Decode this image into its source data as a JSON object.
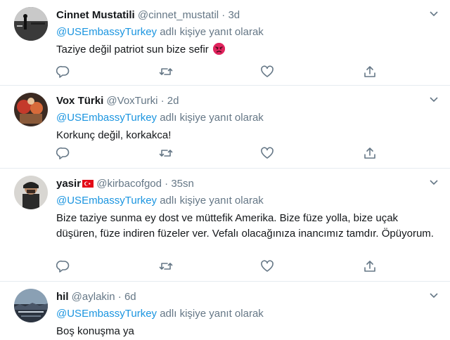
{
  "colors": {
    "accent": "#1b95e0",
    "muted": "#657786",
    "text": "#14171a",
    "divider": "#e6ecf0"
  },
  "tweets": [
    {
      "name": "Cinnet Mustatili",
      "handle": "@cinnet_mustatil",
      "sep": "·",
      "time": "3d",
      "reply_mention": "@USEmbassyTurkey",
      "reply_suffix": " adlı kişiye yanıt olarak",
      "text": "Taziye değil patriot sun bize sefir",
      "emoji": "angry-face-emoji"
    },
    {
      "name": "Vox Türki",
      "handle": "@VoxTurki",
      "sep": "·",
      "time": "2d",
      "reply_mention": "@USEmbassyTurkey",
      "reply_suffix": " adlı kişiye yanıt olarak",
      "text": "Korkunç değil, korkakca!"
    },
    {
      "name": "yasir",
      "flag": "turkey-flag-emoji",
      "handle": "@kirbacofgod",
      "sep": "·",
      "time": "35sn",
      "reply_mention": "@USEmbassyTurkey",
      "reply_suffix": " adlı kişiye yanıt olarak",
      "text": "Bize taziye sunma ey dost ve müttefik Amerika. Bize füze yolla, bize uçak düşüren, füze indiren füzeler ver. Vefalı olacağınıza inancımız tamdır. Öpüyorum."
    },
    {
      "name": "hil",
      "handle": "@aylakin",
      "sep": "·",
      "time": "6d",
      "reply_mention": "@USEmbassyTurkey",
      "reply_suffix": " adlı kişiye yanıt olarak",
      "text": "Boş konuşma ya"
    }
  ],
  "action_icons": [
    "reply-icon",
    "retweet-icon",
    "like-icon",
    "share-icon"
  ]
}
